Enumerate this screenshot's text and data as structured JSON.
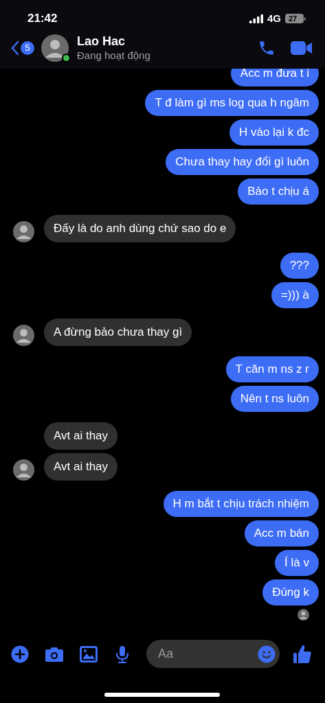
{
  "status_bar": {
    "time": "21:42",
    "network": "4G",
    "battery": "27"
  },
  "header": {
    "unread_count": "5",
    "name": "Lao Hac",
    "status": "Đang hoạt động",
    "online": true
  },
  "messages": [
    {
      "kind": "sent",
      "text": "Acc m đưa t i"
    },
    {
      "kind": "sent",
      "text": "T đ làm gì ms log qua h ngâm"
    },
    {
      "kind": "sent",
      "text": "H vào lại k đc"
    },
    {
      "kind": "sent",
      "text": "Chưa thay hay đổi gì luôn"
    },
    {
      "kind": "sent",
      "text": "Bảo t chịu á"
    },
    {
      "kind": "received",
      "text": "Đấy là do anh dùng chứ sao do e",
      "avatar": true
    },
    {
      "kind": "sent",
      "text": "???"
    },
    {
      "kind": "sent",
      "text": "=))) à"
    },
    {
      "kind": "received",
      "text": "A đừng bảo chưa thay gì",
      "avatar": true
    },
    {
      "kind": "sent",
      "text": "T căn m ns z r"
    },
    {
      "kind": "sent",
      "text": "Nên t ns luôn"
    },
    {
      "kind": "received",
      "text": "Avt ai thay",
      "avatar": false
    },
    {
      "kind": "received",
      "text": "Avt ai thay",
      "avatar": true
    },
    {
      "kind": "sent",
      "text": "H m bắt t chịu trách nhiệm"
    },
    {
      "kind": "sent",
      "text": "Acc m bán"
    },
    {
      "kind": "sent",
      "text": "Í là v"
    },
    {
      "kind": "sent",
      "text": "Đúng k"
    }
  ],
  "seen": true,
  "composer": {
    "placeholder": "Aa"
  }
}
